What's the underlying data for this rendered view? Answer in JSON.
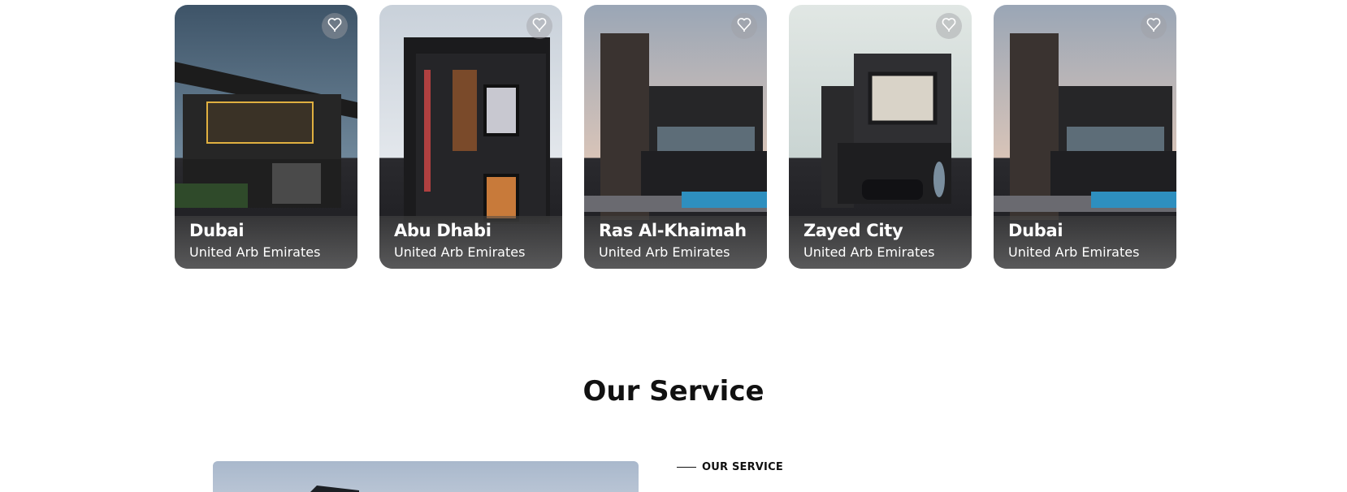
{
  "properties": [
    {
      "city": "Dubai",
      "country": "United Arb Emirates",
      "sky_top": "#3e5468",
      "sky_bottom": "#6f879a"
    },
    {
      "city": "Abu Dhabi",
      "country": "United Arb Emirates",
      "sky_top": "#c9d1da",
      "sky_bottom": "#e3e7ec"
    },
    {
      "city": "Ras Al-Khaimah",
      "country": "United Arb Emirates",
      "sky_top": "#9aa6b6",
      "sky_bottom": "#d8c4b8"
    },
    {
      "city": "Zayed City",
      "country": "United Arb Emirates",
      "sky_top": "#e1e7e4",
      "sky_bottom": "#c9d4d2"
    },
    {
      "city": "Dubai",
      "country": "United Arb Emirates",
      "sky_top": "#9aa6b6",
      "sky_bottom": "#d8c4b8"
    }
  ],
  "favorite_icon": "heart-outline-icon",
  "service": {
    "title": "Our Service",
    "eyebrow": "OUR SERVICE"
  },
  "colors": {
    "text": "#111111",
    "caption_text": "#ffffff"
  }
}
